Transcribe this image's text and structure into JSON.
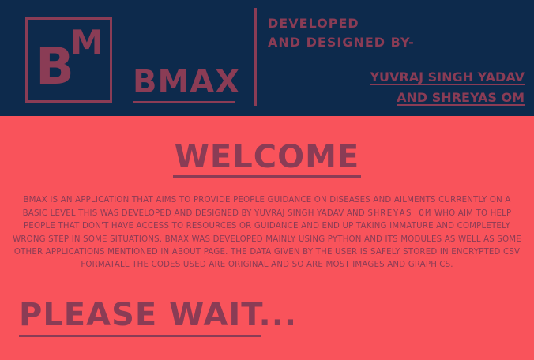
{
  "header": {
    "logo_letter_b": "B",
    "logo_letter_m": "M",
    "app_name": "BMAX",
    "developed_line1": "DEVELOPED",
    "developed_line2": "AND DESIGNED BY-",
    "author1": "YUVRAJ SINGH YADAV",
    "author2": "AND SHREYAS OM"
  },
  "main": {
    "welcome": "WELCOME",
    "description_part1": "BMAX IS AN APPLICATION THAT AIMS TO PROVIDE PEOPLE GUIDANCE ON DISEASES AND AILMENTS CURRENTLY ON A BASIC LEVEL THIS WAS DEVELOPED AND DESIGNED BY YUVRAJ SINGH YADAV AND ",
    "description_highlight": "SHREYAS OM",
    "description_part2": " WHO AIM TO HELP  PEOPLE THAT DON'T HAVE ACCESS TO RESOURCES OR GUIDANCE AND END UP TAKING IMMATURE AND COMPLETELY WRONG STEP IN SOME SITUATIONS. BMAX WAS DEVELOPED MAINLY USING PYTHON AND ITS MODULES AS WELL AS SOME OTHER APPLICATIONS MENTIONED IN ABOUT PAGE. THE DATA GIVEN BY THE USER IS SAFELY STORED IN ENCRYPTED CSV FORMATALL THE CODES USED ARE ORIGINAL AND SO ARE MOST IMAGES AND GRAPHICS.",
    "please_wait": "PLEASE WAIT..."
  },
  "colors": {
    "header_bg": "#0d2a4c",
    "body_bg": "#f9535b",
    "text": "#8a3c55"
  }
}
